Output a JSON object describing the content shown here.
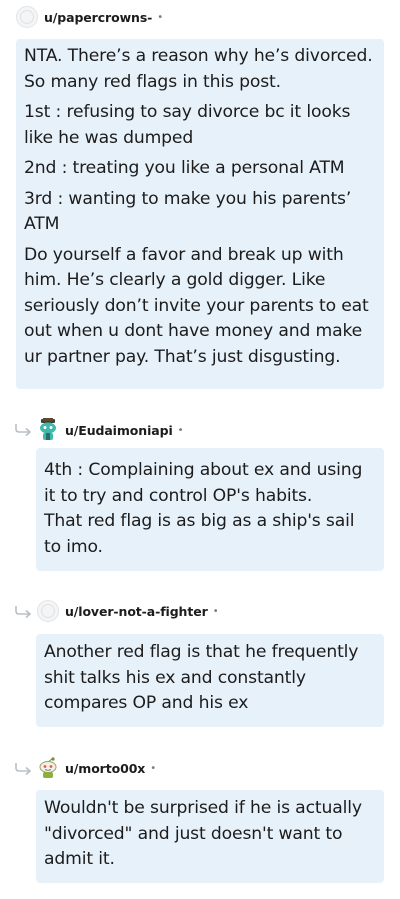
{
  "comments": [
    {
      "username": "u/papercrowns-",
      "separator": "•",
      "paragraphs": [
        "NTA. There’s a reason why he’s divorced. So many red flags in this post.",
        "1st : refusing to say divorce bc it looks like he was dumped",
        "2nd : treating you like a personal ATM",
        "3rd : wanting to make you his parents’ ATM",
        "Do yourself a favor and break up with him. He’s clearly a gold digger. Like seriously don’t invite your parents to eat out when u dont have money and make ur partner pay. That’s just disgusting."
      ]
    },
    {
      "username": "u/Eudaimoniapi",
      "separator": "•",
      "lines": [
        "4th : Complaining about ex and using it to try and control OP's habits.",
        "That red flag is as big as a ship's sail to imo."
      ]
    },
    {
      "username": "u/lover-not-a-fighter",
      "separator": "•",
      "lines": [
        "Another red flag is that he frequently shit talks his ex and constantly compares OP and his ex"
      ]
    },
    {
      "username": "u/morto00x",
      "separator": "•",
      "lines": [
        "Wouldn't be surprised if he is actually \"divorced\" and just doesn't want to admit it."
      ]
    }
  ],
  "colors": {
    "bubble": "#e7f1fa",
    "text": "#1c1c1c",
    "meta": "#7c7c7c",
    "arrow": "#b8c0c6"
  },
  "icons": [
    "avatar-placeholder-icon",
    "snoo-avatar-icon",
    "reply-arrow-icon"
  ]
}
